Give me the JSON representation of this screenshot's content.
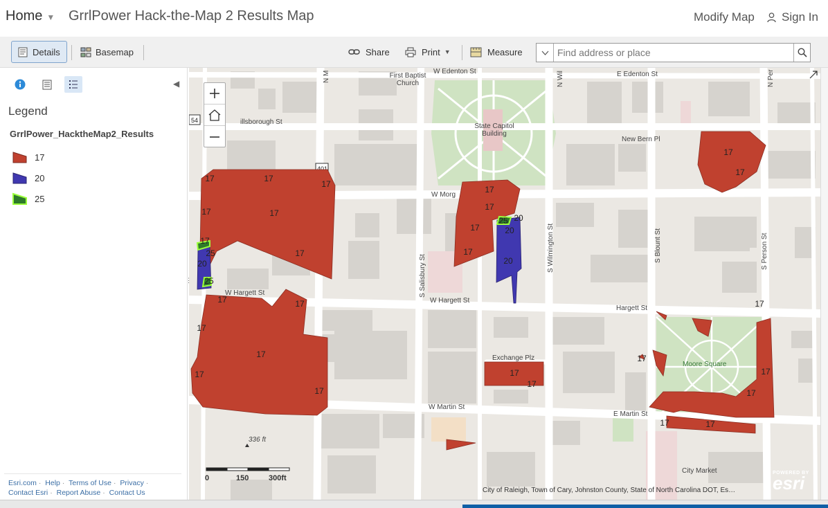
{
  "header": {
    "home_label": "Home",
    "title": "GrrlPower Hack-the-Map 2 Results Map",
    "modify_map": "Modify Map",
    "sign_in": "Sign In"
  },
  "toolbar": {
    "details": "Details",
    "basemap": "Basemap",
    "share": "Share",
    "print": "Print",
    "measure": "Measure",
    "search_placeholder": "Find address or place"
  },
  "panel": {
    "legend_title": "Legend",
    "layer_title": "GrrlPower_HacktheMap2_Results",
    "legend_items": [
      {
        "label": "17",
        "fill": "#c0412f",
        "stroke": "#7a2a20"
      },
      {
        "label": "20",
        "fill": "#4038b0",
        "stroke": "#2a2470"
      },
      {
        "label": "25",
        "fill": "#2e7a2a",
        "stroke": "#9cff3c"
      }
    ],
    "footer_links": [
      "Esri.com",
      "Help",
      "Terms of Use",
      "Privacy",
      "Contact Esri",
      "Report Abuse",
      "Contact Us"
    ]
  },
  "map": {
    "streets": {
      "e_edenton": "E Edenton St",
      "w_edenton": "W Edenton St",
      "hillsborough": "illsborough St",
      "new_bern": "New Bern Pl",
      "w_morgan": "W Morg",
      "w_hargett_left": "W Hargett St",
      "w_hargett_mid": "W Hargett St",
      "hargett": "Hargett St",
      "exchange": "Exchange Plz",
      "w_martin": "W Martin St",
      "e_martin": "E Martin St",
      "s_salisbury": "S Salisbury St",
      "s_wilmington": "S Wilmington St",
      "s_blount": "S Blount St",
      "s_person": "S Person St",
      "n_m": "N M",
      "n_wil": "N Wil",
      "n_per": "N Per"
    },
    "places": {
      "church": "First Baptist Church",
      "capitol": "State Capitol Building",
      "moore_square": "Moore Square",
      "city_market": "City Market"
    },
    "shields": {
      "us401": "401",
      "us54": "54"
    },
    "labels": {
      "a1": "17",
      "a2": "17",
      "a3": "17",
      "a4": "17",
      "a5": "17",
      "a6": "17",
      "a7": "17",
      "b1": "25",
      "b2": "20",
      "b3": "25",
      "c1": "17",
      "c2": "17",
      "c3": "17",
      "c4": "17",
      "c5": "17",
      "c6": "17",
      "d1": "17",
      "d2": "17",
      "d3": "17",
      "d4": "17",
      "e1": "25",
      "e2": "20",
      "e3": "20",
      "e4": "20",
      "f1": "17",
      "f2": "17",
      "g1": "17",
      "g2": "17",
      "h1": "17",
      "h2": "17",
      "h3": "17",
      "h4": "17",
      "h5": "17",
      "h6": "17"
    },
    "elevation": "336 ft",
    "scale": {
      "s0": "0",
      "s150": "150",
      "s300": "300ft"
    },
    "attribution": "City of Raleigh, Town of Cary, Johnston County, State of North Carolina DOT, Es…",
    "esri_powered": "POWERED BY",
    "esri_name": "esri"
  }
}
